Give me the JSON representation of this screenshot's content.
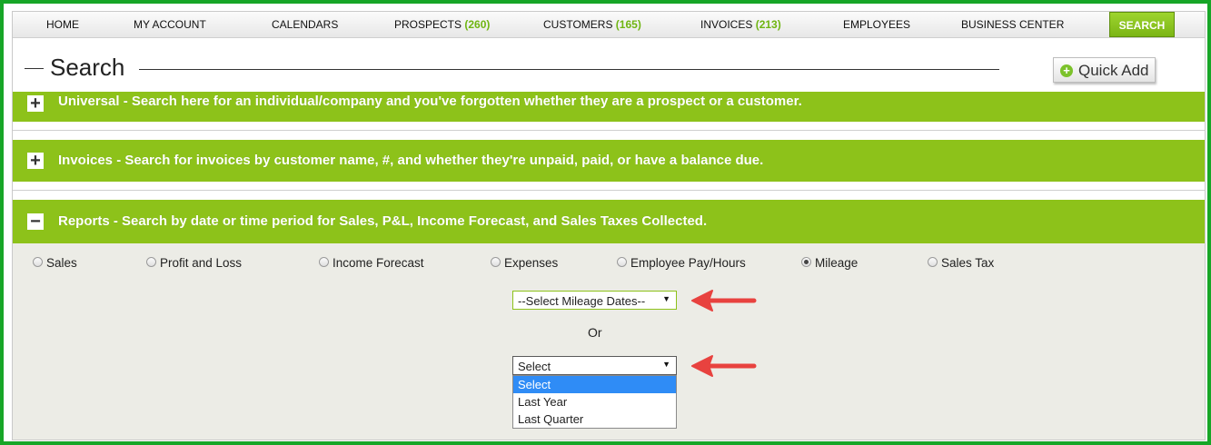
{
  "nav": {
    "home": "HOME",
    "my_account": "MY ACCOUNT",
    "calendars": "CALENDARS",
    "prospects": "PROSPECTS",
    "prospects_count": "(260)",
    "customers": "CUSTOMERS",
    "customers_count": "(165)",
    "invoices": "INVOICES",
    "invoices_count": "(213)",
    "employees": "EMPLOYEES",
    "business_center": "BUSINESS CENTER",
    "search": "SEARCH"
  },
  "page": {
    "title": "Search",
    "quick_add": "Quick Add"
  },
  "sections": {
    "universal": "Universal - Search here for an individual/company and you've forgotten whether they are a prospect or a customer.",
    "invoices": "Invoices - Search for invoices by customer name, #, and whether they're unpaid, paid, or have a balance due.",
    "reports": "Reports - Search by date or time period for Sales, P&L, Income Forecast, and Sales Taxes Collected."
  },
  "report_types": [
    "Sales",
    "Profit and Loss",
    "Income Forecast",
    "Expenses",
    "Employee Pay/Hours",
    "Mileage",
    "Sales Tax"
  ],
  "selected_report": "Mileage",
  "mileage_dates_select": "--Select Mileage Dates--",
  "or_label": "Or",
  "period_select": {
    "value": "Select",
    "options": [
      "Select",
      "Last Year",
      "Last Quarter"
    ]
  },
  "colors": {
    "accent_green": "#8dc21a",
    "frame_green": "#17a627",
    "annotation_red": "#e8423f",
    "selected_option_blue": "#2f8cf6"
  }
}
